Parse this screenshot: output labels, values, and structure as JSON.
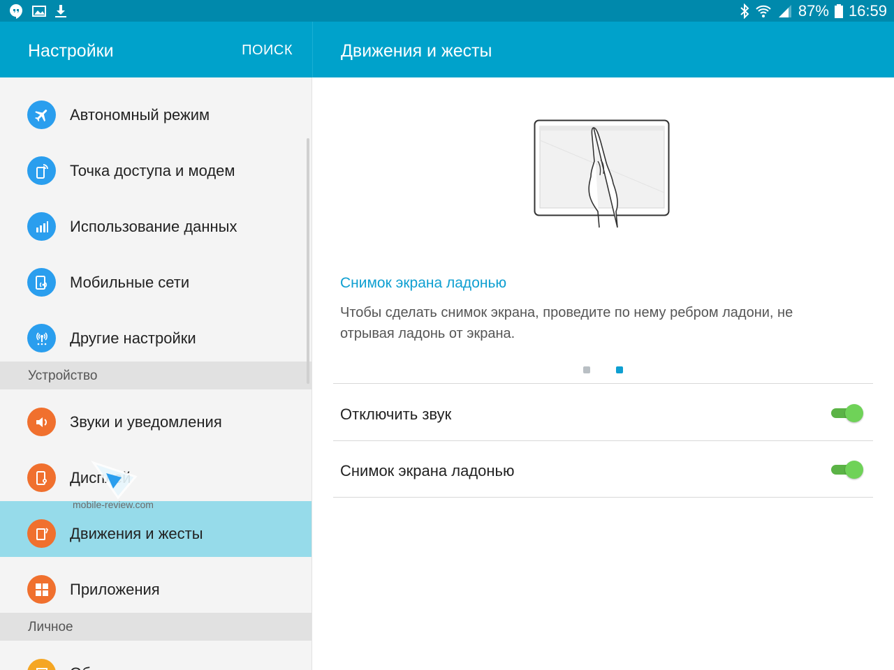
{
  "status_bar": {
    "battery": "87%",
    "time": "16:59",
    "icons_left": [
      "hangouts-icon",
      "gallery-icon",
      "download-icon"
    ],
    "icons_right": [
      "bluetooth-icon",
      "wifi-icon",
      "signal-icon",
      "battery-icon"
    ]
  },
  "left_header": {
    "title": "Настройки",
    "search": "ПОИСК"
  },
  "right_header": {
    "title": "Движения и жесты"
  },
  "sidebar": {
    "items": [
      {
        "label": "Автономный режим",
        "icon": "airplane-icon",
        "color": "#2a9eee"
      },
      {
        "label": "Точка доступа и модем",
        "icon": "hotspot-icon",
        "color": "#2a9eee"
      },
      {
        "label": "Использование данных",
        "icon": "data-usage-icon",
        "color": "#2a9eee"
      },
      {
        "label": "Мобильные сети",
        "icon": "mobile-networks-icon",
        "color": "#2a9eee"
      },
      {
        "label": "Другие настройки",
        "icon": "more-settings-icon",
        "color": "#2a9eee"
      }
    ],
    "section_device": "Устройство",
    "device_items": [
      {
        "label": "Звуки и уведомления",
        "icon": "speaker-icon",
        "color": "#f0702e"
      },
      {
        "label": "Дисплей",
        "icon": "display-icon",
        "color": "#f0702e"
      },
      {
        "label": "Движения и жесты",
        "icon": "motion-icon",
        "color": "#f0702e",
        "active": true
      },
      {
        "label": "Приложения",
        "icon": "apps-icon",
        "color": "#f0702e"
      }
    ],
    "section_personal": "Личное",
    "personal_items": [
      {
        "label": "Обои",
        "icon": "wallpaper-icon",
        "color": "#f5a623"
      }
    ]
  },
  "watermark": "mobile-review.com",
  "main": {
    "feature_title": "Снимок экрана ладонью",
    "feature_desc": "Чтобы сделать снимок экрана, проведите по нему ребром ладони, не отрывая ладонь от экрана.",
    "page_indicator": {
      "total": 2,
      "current": 2
    },
    "settings": [
      {
        "label": "Отключить звук",
        "enabled": true
      },
      {
        "label": "Снимок экрана ладонью",
        "enabled": true
      }
    ]
  },
  "colors": {
    "accent": "#00a2cb",
    "status_bar": "#0089ac",
    "active_item": "#96dbea",
    "toggle_on": "#6fd258",
    "link_blue": "#0e9fd1"
  }
}
